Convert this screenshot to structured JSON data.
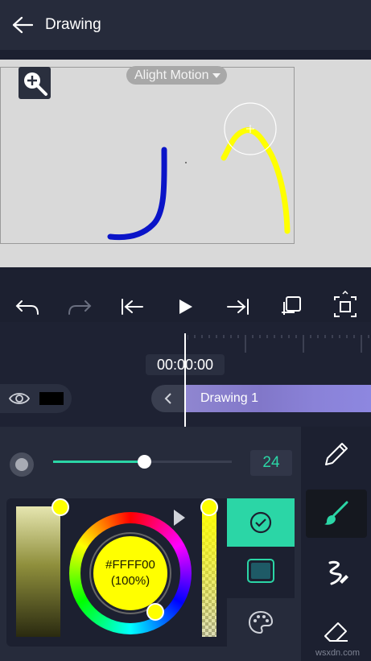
{
  "header": {
    "title": "Drawing",
    "back_icon": "arrow-left-icon"
  },
  "canvas": {
    "watermark": "Alight Motion",
    "stroke_colors": {
      "blue": "#0a14c8",
      "yellow": "#ffff00"
    }
  },
  "toolbar": {
    "items": [
      "undo-icon",
      "redo-icon",
      "skip-to-start-icon",
      "play-icon",
      "skip-to-end-icon",
      "duplicate-icon",
      "fit-screen-icon"
    ]
  },
  "timeline": {
    "timecode": "00:00:00",
    "clip_label": "Drawing 1"
  },
  "brush": {
    "size": "24",
    "slider_fraction": 0.51
  },
  "color": {
    "hex": "#FFFF00",
    "opacity": "(100%)",
    "accent": "#2bd6a6"
  },
  "side_tools": [
    "pencil-icon",
    "brush-icon",
    "smudge-icon",
    "eraser-icon"
  ],
  "footer": {
    "watermark": "wsxdn.com"
  }
}
